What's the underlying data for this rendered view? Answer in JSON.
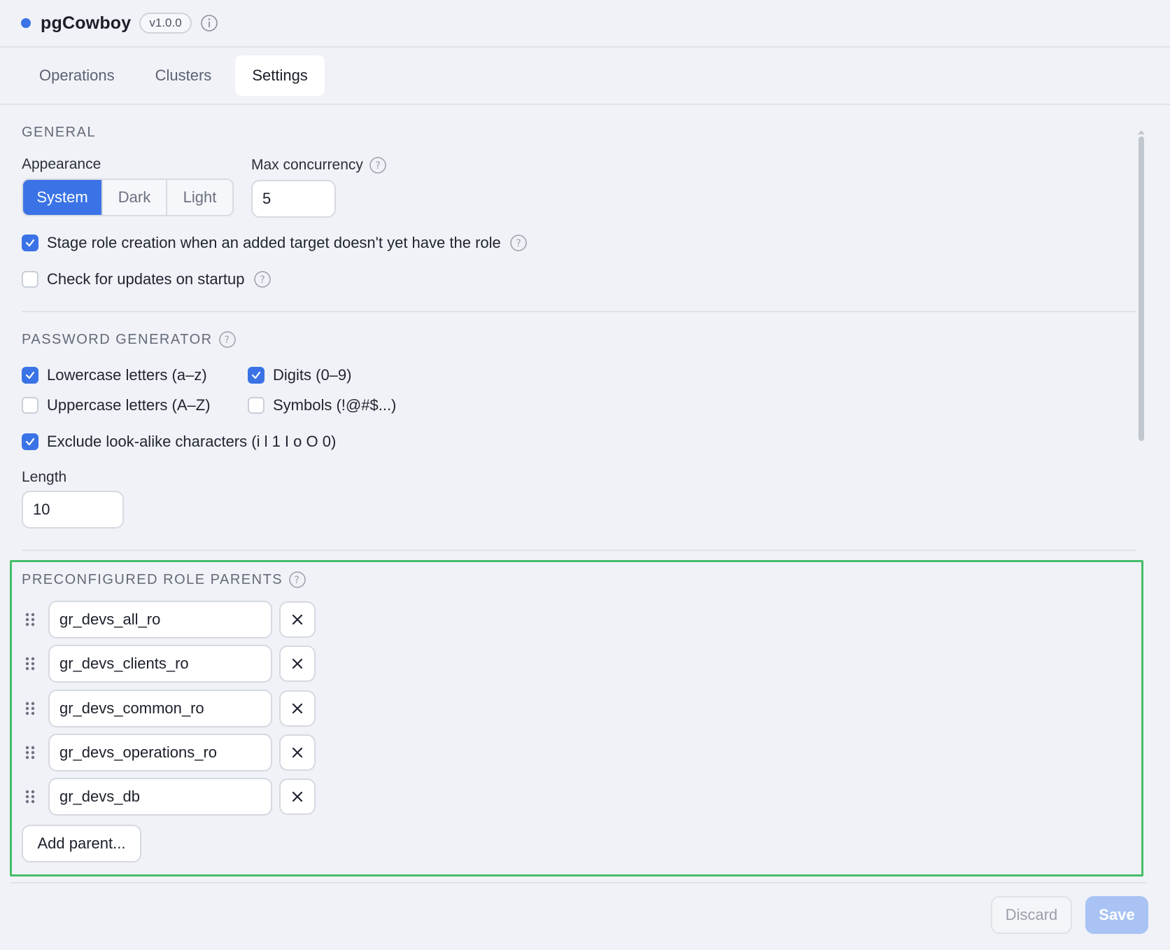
{
  "app": {
    "title": "pgCowboy",
    "version": "v1.0.0"
  },
  "tabs": [
    {
      "label": "Operations",
      "active": false
    },
    {
      "label": "Clusters",
      "active": false
    },
    {
      "label": "Settings",
      "active": true
    }
  ],
  "general": {
    "section_title": "GENERAL",
    "appearance_label": "Appearance",
    "appearance_options": [
      "System",
      "Dark",
      "Light"
    ],
    "appearance_selected": "System",
    "max_concurrency_label": "Max concurrency",
    "max_concurrency_value": "5",
    "stage_role_label": "Stage role creation when an added target doesn't yet have the role",
    "stage_role_checked": true,
    "check_updates_label": "Check for updates on startup",
    "check_updates_checked": false
  },
  "password_generator": {
    "section_title": "PASSWORD GENERATOR",
    "lowercase_label": "Lowercase letters (a–z)",
    "lowercase_checked": true,
    "digits_label": "Digits (0–9)",
    "digits_checked": true,
    "uppercase_label": "Uppercase letters (A–Z)",
    "uppercase_checked": false,
    "symbols_label": "Symbols (!@#$...)",
    "symbols_checked": false,
    "exclude_label": "Exclude look-alike characters (i l 1 I o O 0)",
    "exclude_checked": true,
    "length_label": "Length",
    "length_value": "10"
  },
  "role_parents": {
    "section_title": "PRECONFIGURED ROLE PARENTS",
    "items": [
      "gr_devs_all_ro",
      "gr_devs_clients_ro",
      "gr_devs_common_ro",
      "gr_devs_operations_ro",
      "gr_devs_db"
    ],
    "add_label": "Add parent..."
  },
  "footer": {
    "discard_label": "Discard",
    "save_label": "Save"
  },
  "colors": {
    "accent": "#3b73e6",
    "highlight": "#45bd6a",
    "save_disabled": "#a8c3f4"
  },
  "icons": {
    "info": "info-icon",
    "help": "help-circle-icon",
    "drag": "drag-handle-icon",
    "remove": "close-icon",
    "check": "checkmark-icon"
  }
}
